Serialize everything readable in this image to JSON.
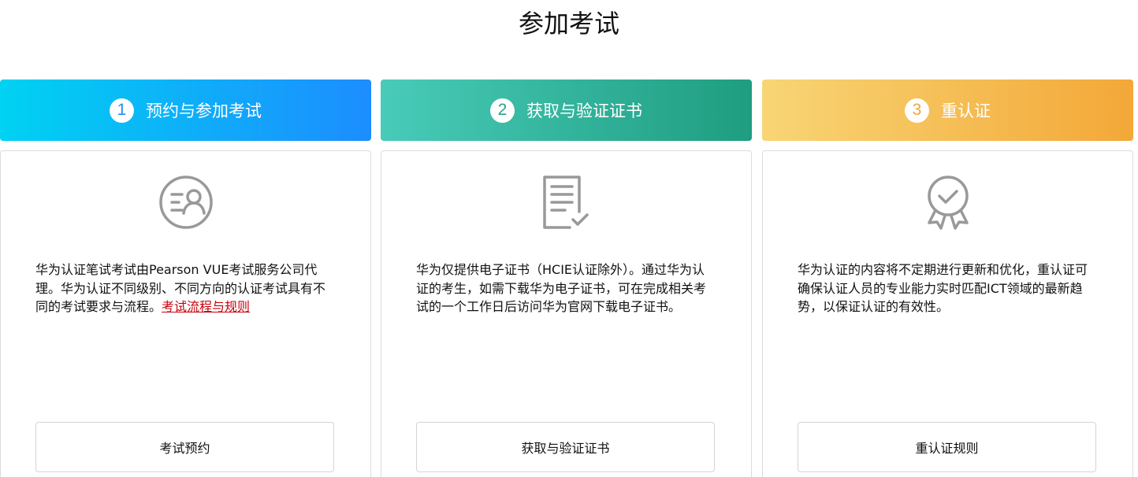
{
  "page": {
    "title": "参加考试"
  },
  "steps": [
    {
      "number": "1",
      "title": "预约与参加考试",
      "icon": "exam-profile-icon",
      "text_before_link": "华为认证笔试考试由Pearson VUE考试服务公司代理。华为认证不同级别、不同方向的认证考试具有不同的考试要求与流程。",
      "link_label": "考试流程与规则",
      "button_label": "考试预约"
    },
    {
      "number": "2",
      "title": "获取与验证证书",
      "icon": "certificate-document-icon",
      "text": "华为仅提供电子证书（HCIE认证除外）。通过华为认证的考生，如需下载华为电子证书，可在完成相关考试的一个工作日后访问华为官网下载电子证书。",
      "button_label": "获取与验证证书"
    },
    {
      "number": "3",
      "title": "重认证",
      "icon": "award-badge-icon",
      "text": "华为认证的内容将不定期进行更新和优化，重认证可确保认证人员的专业能力实时匹配ICT领域的最新趋势，以保证认证的有效性。",
      "button_label": "重认证规则"
    }
  ],
  "colors": {
    "step1_gradient": [
      "#00d2f2",
      "#1c8dff"
    ],
    "step2_gradient": [
      "#48cbb9",
      "#1f9d80"
    ],
    "step3_gradient": [
      "#f8d575",
      "#f3a838"
    ],
    "link": "#c7000b",
    "icon_stroke": "#999999"
  }
}
